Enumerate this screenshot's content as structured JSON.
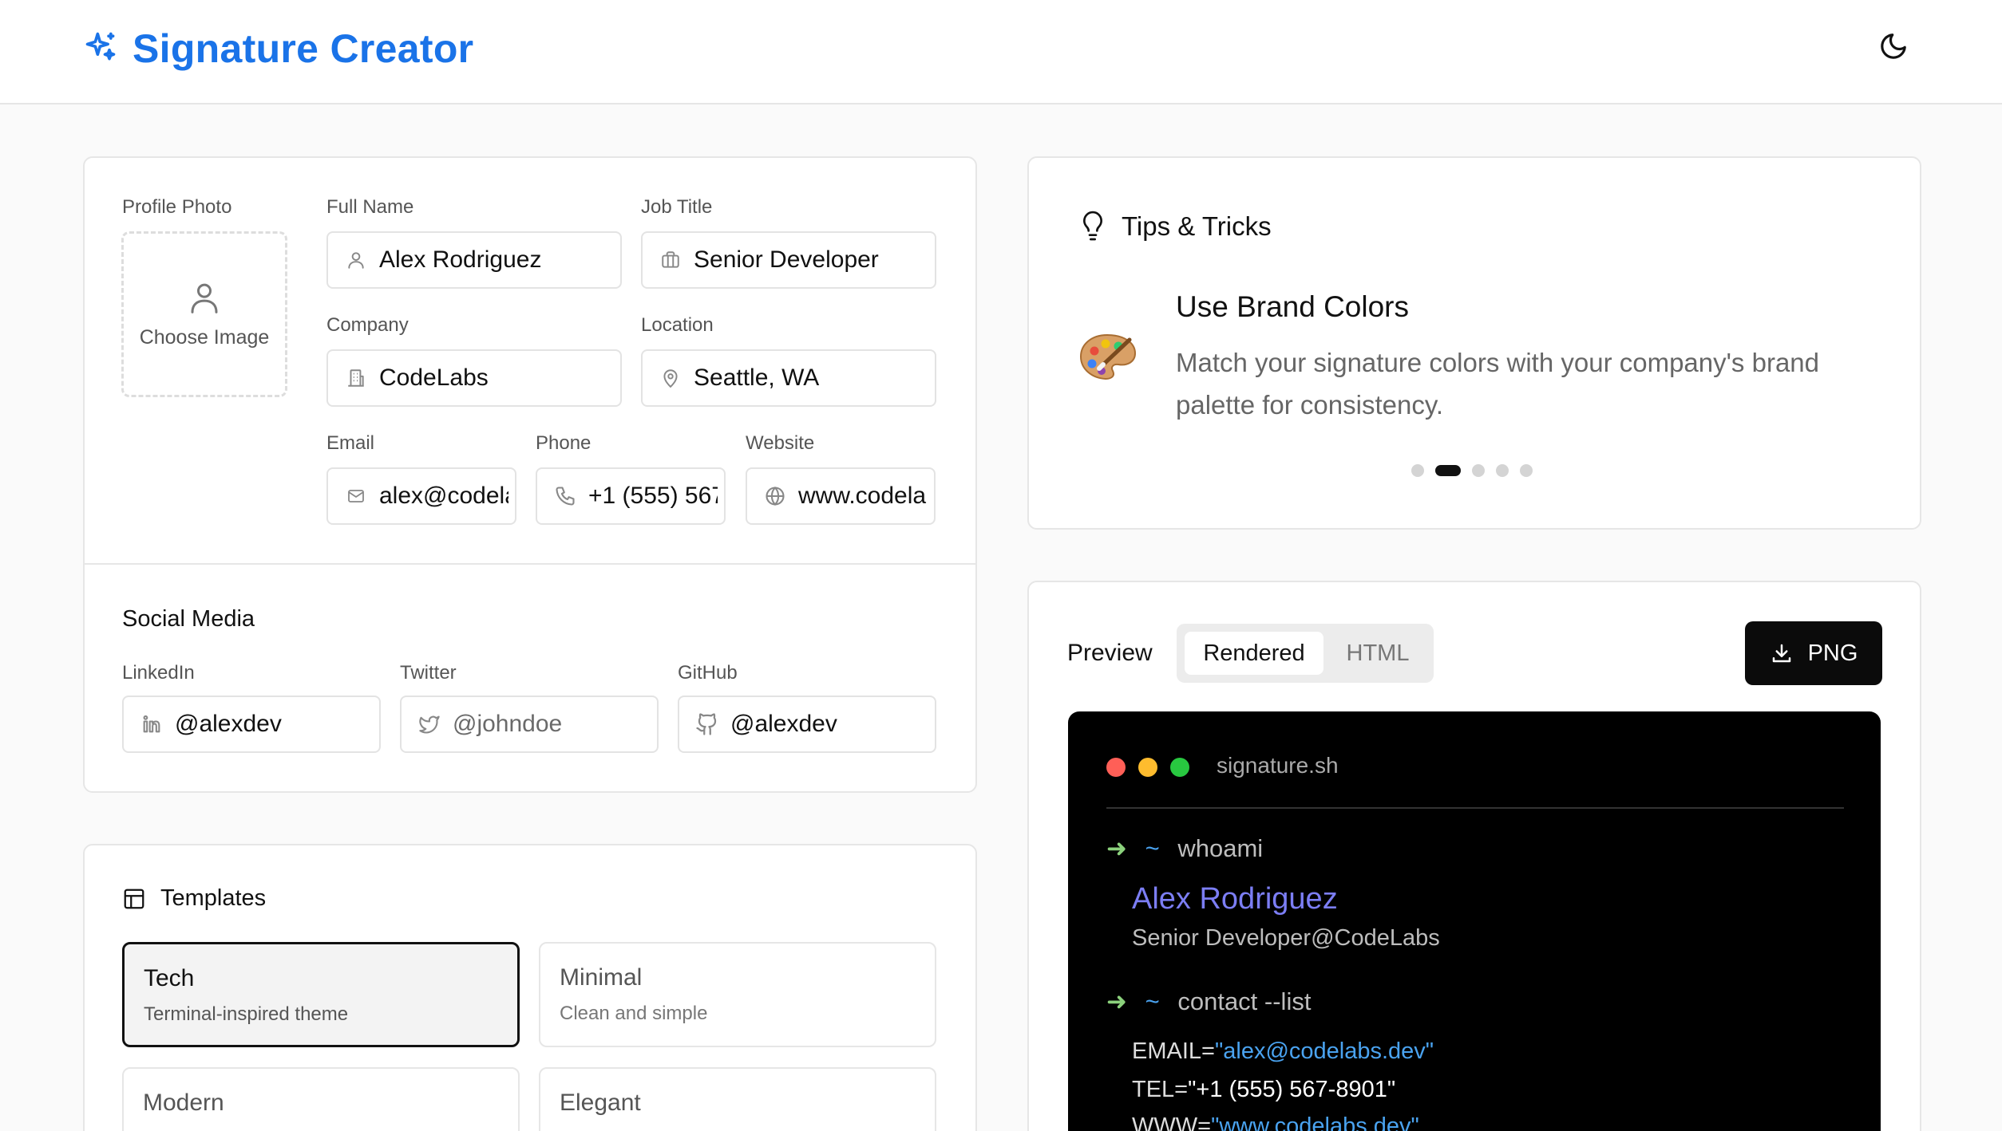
{
  "header": {
    "title": "Signature Creator",
    "logo_icon": "sparkles-icon",
    "theme_icon": "moon-icon"
  },
  "profile": {
    "photo_label": "Profile Photo",
    "photo_button": "Choose Image",
    "full_name": {
      "label": "Full Name",
      "value": "Alex Rodriguez"
    },
    "job_title": {
      "label": "Job Title",
      "value": "Senior Developer"
    },
    "company": {
      "label": "Company",
      "value": "CodeLabs"
    },
    "location": {
      "label": "Location",
      "value": "Seattle, WA"
    },
    "email": {
      "label": "Email",
      "value": "alex@codelabs.dev"
    },
    "phone": {
      "label": "Phone",
      "value": "+1 (555) 567-8901"
    },
    "website": {
      "label": "Website",
      "value": "www.codelabs.dev"
    }
  },
  "social": {
    "title": "Social Media",
    "linkedin": {
      "label": "LinkedIn",
      "value": "@alexdev",
      "placeholder": ""
    },
    "twitter": {
      "label": "Twitter",
      "value": "",
      "placeholder": "@johndoe"
    },
    "github": {
      "label": "GitHub",
      "value": "@alexdev",
      "placeholder": ""
    }
  },
  "templates": {
    "title": "Templates",
    "items": [
      {
        "name": "Tech",
        "desc": "Terminal-inspired theme",
        "active": true
      },
      {
        "name": "Minimal",
        "desc": "Clean and simple",
        "active": false
      },
      {
        "name": "Modern",
        "desc": "",
        "active": false
      },
      {
        "name": "Elegant",
        "desc": "",
        "active": false
      }
    ]
  },
  "tips": {
    "title": "Tips & Tricks",
    "tip_title": "Use Brand Colors",
    "tip_text": "Match your signature colors with your company's brand palette for consistency.",
    "active_dot": 2,
    "dot_count": 5
  },
  "preview": {
    "label": "Preview",
    "tabs": [
      "Rendered",
      "HTML"
    ],
    "active_tab": "Rendered",
    "download_label": "PNG",
    "terminal": {
      "window_title": "signature.sh",
      "prompt_symbol": "~",
      "cmd1": "whoami",
      "name": "Alex Rodriguez",
      "subtitle": "Senior Developer@CodeLabs",
      "cmd2": "contact --list",
      "email_key": "EMAIL=",
      "email_val": "\"alex@codelabs.dev\"",
      "tel_key": "TEL=",
      "tel_val": "\"+1 (555) 567-8901\"",
      "www_key": "WWW=",
      "www_val": "\"www.codelabs.dev\""
    }
  },
  "colors": {
    "brand": "#1a73e8",
    "terminal_bg": "#000000",
    "mac_red": "#ff5f57",
    "mac_yellow": "#febc2e",
    "mac_green": "#28c840",
    "name_purple": "#7c7ef5",
    "string_blue": "#4aa3f0",
    "prompt_green": "#8bd17c"
  }
}
